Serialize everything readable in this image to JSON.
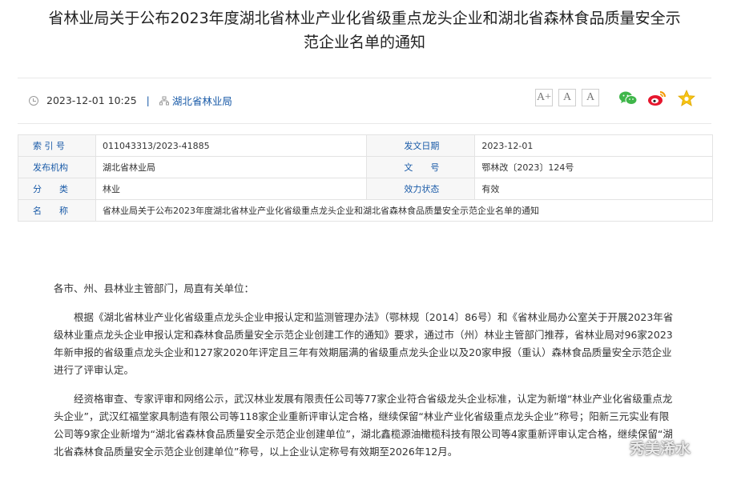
{
  "article": {
    "title_line1": "省林业局关于公布2023年度湖北省林业产业化省级重点龙头企业和湖北省森林食品质量安全示",
    "title_line2": "范企业名单的通知",
    "datetime": "2023-12-01 10:25",
    "separator": "|",
    "source": "湖北省林业局",
    "font_buttons": [
      "A+",
      "A",
      "A"
    ],
    "share_icons": [
      "wechat-icon",
      "weibo-icon",
      "favorite-star-icon"
    ]
  },
  "info_table": {
    "rows": [
      {
        "l1": "索 引 号",
        "v1": "011043313/2023-41885",
        "l2": "发文日期",
        "v2": "2023-12-01"
      },
      {
        "l1": "发布机构",
        "v1": "湖北省林业局",
        "l2": "文　　号",
        "v2": "鄂林改〔2023〕124号"
      },
      {
        "l1": "分　　类",
        "v1": "林业",
        "l2": "效力状态",
        "v2": "有效"
      }
    ],
    "name_label": "名　　称",
    "name_value": "省林业局关于公布2023年度湖北省林业产业化省级重点龙头企业和湖北省森林食品质量安全示范企业名单的通知"
  },
  "body": {
    "salutation": "各市、州、县林业主管部门，局直有关单位：",
    "para1": "根据《湖北省林业产业化省级重点龙头企业申报认定和监测管理办法》（鄂林规〔2014〕86号）和《省林业局办公室关于开展2023年省级林业重点龙头企业申报认定和森林食品质量安全示范企业创建工作的通知》要求，通过市（州）林业主管部门推荐，省林业局对96家2023年新申报的省级重点龙头企业和127家2020年评定且三年有效期届满的省级重点龙头企业以及20家申报（重认）森林食品质量安全示范企业进行了评审认定。",
    "para2": "经资格审查、专家评审和网络公示，武汉林业发展有限责任公司等77家企业符合省级龙头企业标准，认定为新增“林业产业化省级重点龙头企业”，武汉红福堂家具制造有限公司等118家企业重新评审认定合格，继续保留“林业产业化省级重点龙头企业”称号；阳新三元实业有限公司等9家企业新增为“湖北省森林食品质量安全示范企业创建单位”，湖北鑫榄源油橄榄科技有限公司等4家重新评审认定合格，继续保留“湖北省森林食品质量安全示范企业创建单位”称号，以上企业认定称号有效期至2026年12月。"
  },
  "watermark": {
    "text": "秀美浠水"
  }
}
